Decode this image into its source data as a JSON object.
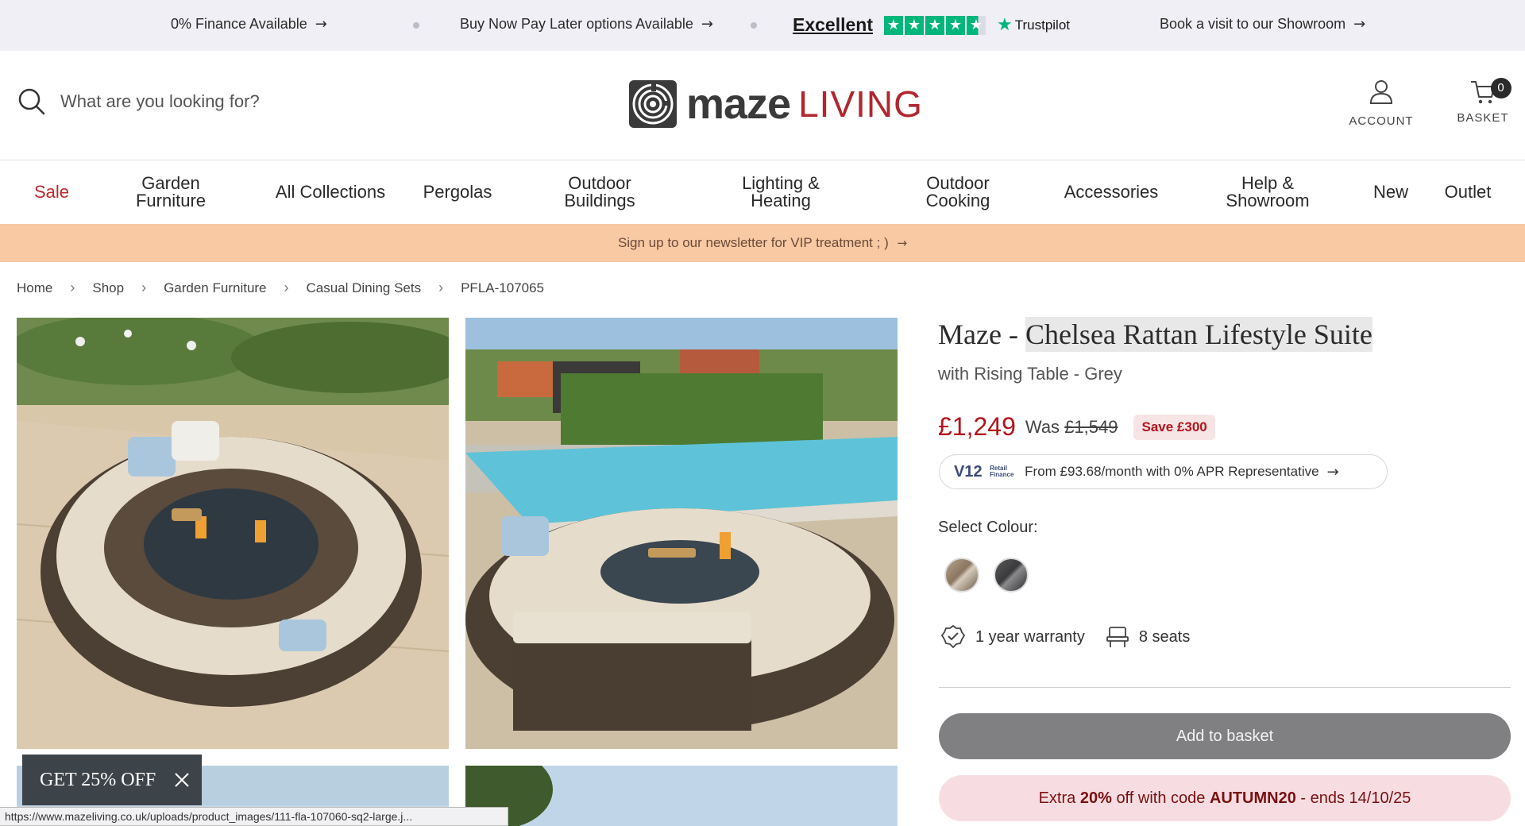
{
  "topbar": {
    "finance": "0% Finance Available",
    "bnpl": "Buy Now Pay Later options Available",
    "trustpilot_rating": "Excellent",
    "trustpilot_brand": "Trustpilot",
    "showroom": "Book a visit to our Showroom"
  },
  "header": {
    "search_placeholder": "What are you looking for?",
    "logo_main": "maze",
    "logo_sub": "LIVING",
    "account_label": "ACCOUNT",
    "basket_label": "BASKET",
    "basket_count": "0"
  },
  "nav": {
    "sale": "Sale",
    "garden_furniture": "Garden Furniture",
    "all_collections": "All Collections",
    "pergolas": "Pergolas",
    "outdoor_buildings": "Outdoor Buildings",
    "lighting_heating": "Lighting & Heating",
    "outdoor_cooking": "Outdoor Cooking",
    "accessories": "Accessories",
    "help_showroom": "Help & Showroom",
    "new": "New",
    "outlet": "Outlet"
  },
  "newsletter": "Sign up to our newsletter for VIP treatment ; )",
  "breadcrumb": [
    "Home",
    "Shop",
    "Garden Furniture",
    "Casual Dining Sets",
    "PFLA-107065"
  ],
  "product": {
    "title_prefix": "Maze - ",
    "title_main": "Chelsea Rattan Lifestyle Suite",
    "subtitle": "with Rising Table - Grey",
    "price": "£1,249",
    "was_label": "Was",
    "was_price": "£1,549",
    "save": "Save £300",
    "finance_logo": "V12",
    "finance_logo_small": "Retail Finance",
    "finance_text": "From £93.68/month with 0% APR Representative",
    "select_colour": "Select Colour:",
    "colours": [
      "Brown",
      "Grey"
    ],
    "warranty": "1 year warranty",
    "seats": "8 seats",
    "add_to_basket": "Add to basket",
    "promo_extra": "Extra",
    "promo_percent": "20%",
    "promo_mid": "off with code",
    "promo_code": "AUTUMN20",
    "promo_end": "- ends 14/10/25"
  },
  "overlay": {
    "get_off": "GET 25% OFF",
    "status_url": "https://www.mazeliving.co.uk/uploads/product_images/111-fla-107060-sq2-large.j..."
  },
  "colors": {
    "accent_red": "#b3141c",
    "trustpilot_green": "#00b67a",
    "newsletter_bg": "#f8c9a3",
    "topbar_bg": "#efeff5"
  }
}
